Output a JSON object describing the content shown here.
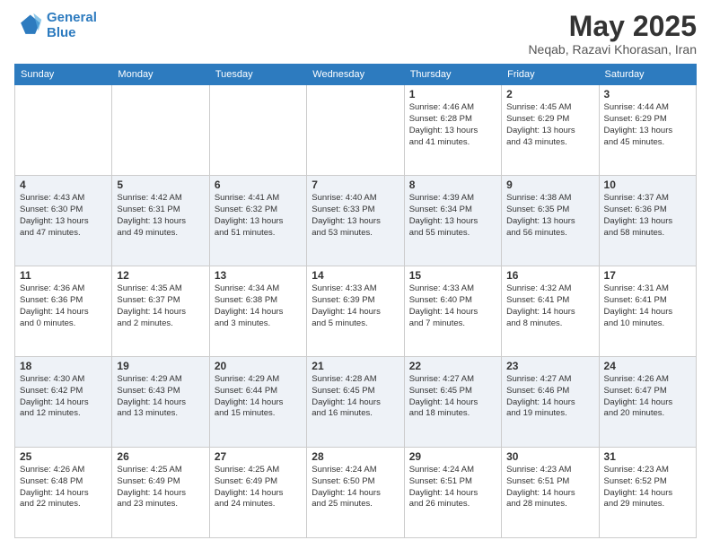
{
  "header": {
    "logo_line1": "General",
    "logo_line2": "Blue",
    "title": "May 2025",
    "subtitle": "Neqab, Razavi Khorasan, Iran"
  },
  "days_of_week": [
    "Sunday",
    "Monday",
    "Tuesday",
    "Wednesday",
    "Thursday",
    "Friday",
    "Saturday"
  ],
  "weeks": [
    [
      {
        "day": "",
        "info": ""
      },
      {
        "day": "",
        "info": ""
      },
      {
        "day": "",
        "info": ""
      },
      {
        "day": "",
        "info": ""
      },
      {
        "day": "1",
        "info": "Sunrise: 4:46 AM\nSunset: 6:28 PM\nDaylight: 13 hours\nand 41 minutes."
      },
      {
        "day": "2",
        "info": "Sunrise: 4:45 AM\nSunset: 6:29 PM\nDaylight: 13 hours\nand 43 minutes."
      },
      {
        "day": "3",
        "info": "Sunrise: 4:44 AM\nSunset: 6:29 PM\nDaylight: 13 hours\nand 45 minutes."
      }
    ],
    [
      {
        "day": "4",
        "info": "Sunrise: 4:43 AM\nSunset: 6:30 PM\nDaylight: 13 hours\nand 47 minutes."
      },
      {
        "day": "5",
        "info": "Sunrise: 4:42 AM\nSunset: 6:31 PM\nDaylight: 13 hours\nand 49 minutes."
      },
      {
        "day": "6",
        "info": "Sunrise: 4:41 AM\nSunset: 6:32 PM\nDaylight: 13 hours\nand 51 minutes."
      },
      {
        "day": "7",
        "info": "Sunrise: 4:40 AM\nSunset: 6:33 PM\nDaylight: 13 hours\nand 53 minutes."
      },
      {
        "day": "8",
        "info": "Sunrise: 4:39 AM\nSunset: 6:34 PM\nDaylight: 13 hours\nand 55 minutes."
      },
      {
        "day": "9",
        "info": "Sunrise: 4:38 AM\nSunset: 6:35 PM\nDaylight: 13 hours\nand 56 minutes."
      },
      {
        "day": "10",
        "info": "Sunrise: 4:37 AM\nSunset: 6:36 PM\nDaylight: 13 hours\nand 58 minutes."
      }
    ],
    [
      {
        "day": "11",
        "info": "Sunrise: 4:36 AM\nSunset: 6:36 PM\nDaylight: 14 hours\nand 0 minutes."
      },
      {
        "day": "12",
        "info": "Sunrise: 4:35 AM\nSunset: 6:37 PM\nDaylight: 14 hours\nand 2 minutes."
      },
      {
        "day": "13",
        "info": "Sunrise: 4:34 AM\nSunset: 6:38 PM\nDaylight: 14 hours\nand 3 minutes."
      },
      {
        "day": "14",
        "info": "Sunrise: 4:33 AM\nSunset: 6:39 PM\nDaylight: 14 hours\nand 5 minutes."
      },
      {
        "day": "15",
        "info": "Sunrise: 4:33 AM\nSunset: 6:40 PM\nDaylight: 14 hours\nand 7 minutes."
      },
      {
        "day": "16",
        "info": "Sunrise: 4:32 AM\nSunset: 6:41 PM\nDaylight: 14 hours\nand 8 minutes."
      },
      {
        "day": "17",
        "info": "Sunrise: 4:31 AM\nSunset: 6:41 PM\nDaylight: 14 hours\nand 10 minutes."
      }
    ],
    [
      {
        "day": "18",
        "info": "Sunrise: 4:30 AM\nSunset: 6:42 PM\nDaylight: 14 hours\nand 12 minutes."
      },
      {
        "day": "19",
        "info": "Sunrise: 4:29 AM\nSunset: 6:43 PM\nDaylight: 14 hours\nand 13 minutes."
      },
      {
        "day": "20",
        "info": "Sunrise: 4:29 AM\nSunset: 6:44 PM\nDaylight: 14 hours\nand 15 minutes."
      },
      {
        "day": "21",
        "info": "Sunrise: 4:28 AM\nSunset: 6:45 PM\nDaylight: 14 hours\nand 16 minutes."
      },
      {
        "day": "22",
        "info": "Sunrise: 4:27 AM\nSunset: 6:45 PM\nDaylight: 14 hours\nand 18 minutes."
      },
      {
        "day": "23",
        "info": "Sunrise: 4:27 AM\nSunset: 6:46 PM\nDaylight: 14 hours\nand 19 minutes."
      },
      {
        "day": "24",
        "info": "Sunrise: 4:26 AM\nSunset: 6:47 PM\nDaylight: 14 hours\nand 20 minutes."
      }
    ],
    [
      {
        "day": "25",
        "info": "Sunrise: 4:26 AM\nSunset: 6:48 PM\nDaylight: 14 hours\nand 22 minutes."
      },
      {
        "day": "26",
        "info": "Sunrise: 4:25 AM\nSunset: 6:49 PM\nDaylight: 14 hours\nand 23 minutes."
      },
      {
        "day": "27",
        "info": "Sunrise: 4:25 AM\nSunset: 6:49 PM\nDaylight: 14 hours\nand 24 minutes."
      },
      {
        "day": "28",
        "info": "Sunrise: 4:24 AM\nSunset: 6:50 PM\nDaylight: 14 hours\nand 25 minutes."
      },
      {
        "day": "29",
        "info": "Sunrise: 4:24 AM\nSunset: 6:51 PM\nDaylight: 14 hours\nand 26 minutes."
      },
      {
        "day": "30",
        "info": "Sunrise: 4:23 AM\nSunset: 6:51 PM\nDaylight: 14 hours\nand 28 minutes."
      },
      {
        "day": "31",
        "info": "Sunrise: 4:23 AM\nSunset: 6:52 PM\nDaylight: 14 hours\nand 29 minutes."
      }
    ]
  ]
}
